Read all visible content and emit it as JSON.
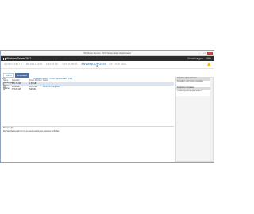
{
  "window": {
    "title": "Windows Server 2012 Essentials-Dashboard"
  },
  "header": {
    "product": "Windows Server 2012",
    "right_items": [
      "Einstellungen",
      "Hilfe"
    ]
  },
  "nav": {
    "tabs": [
      "STARTSEITE",
      "BENUTZER",
      "GERÄTE",
      "SPEICHER",
      "ANWENDUNGEN",
      "OFFICE 365"
    ],
    "active_index": 4
  },
  "subtabs": [
    "Ordner",
    "Festplatten"
  ],
  "filters": [
    "Filter",
    "Freigabe erstellen",
    "Freier Speicherplatz",
    "Pfad"
  ],
  "list": {
    "headers": [
      "Name",
      "Kapazität",
      "Freier Speicher",
      "Status"
    ],
    "rows": [
      {
        "name": "Datenträger 0",
        "capacity": "465,76 GB",
        "free": "1,99 GB",
        "status": "",
        "selected": true
      },
      {
        "name": "Volume (C:)",
        "capacity": "60,00 GB",
        "free": "10,45 GB",
        "status": "Fehlerfrei (Integrität)",
        "selected": false
      },
      {
        "name": "Volume (E:)",
        "capacity": "373,88 GB",
        "free": "348 GB",
        "status": "",
        "selected": false
      }
    ]
  },
  "detail": {
    "title": "Warnung (M)",
    "text": "Der Speicherbereich ist nur zu einem bestimmten Zeitraum verfügbar."
  },
  "side": {
    "panels": [
      {
        "heading": "Aufgaben (E) bearbeiten",
        "body": "Freigaben und Ordner verwalten"
      },
      {
        "heading": "Festplatten-Aufgaben",
        "body": "Ordner/Speicherpool erstellen"
      }
    ]
  }
}
